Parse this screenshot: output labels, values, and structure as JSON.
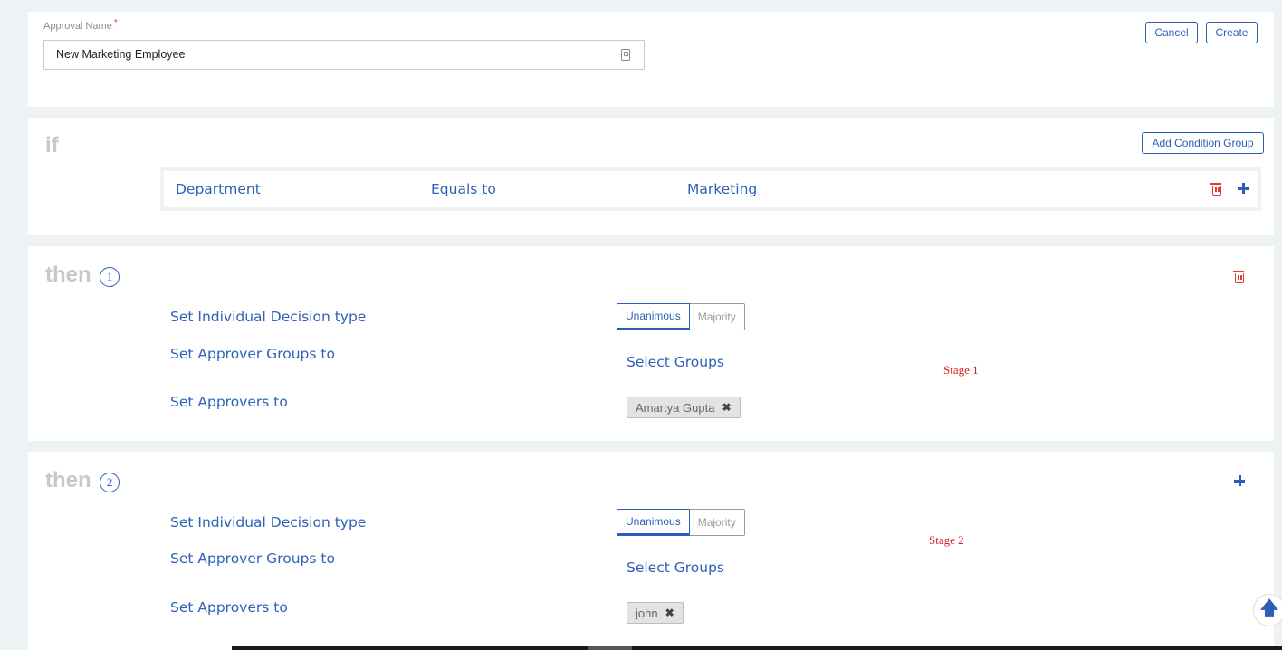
{
  "approval": {
    "label": "Approval Name",
    "required_mark": "*",
    "value": "New Marketing Employee",
    "cancel_label": "Cancel",
    "create_label": "Create"
  },
  "if_section": {
    "keyword": "if",
    "add_condition_group_label": "Add Condition Group",
    "condition": {
      "field": "Department",
      "operator": "Equals to",
      "value": "Marketing"
    }
  },
  "stages": [
    {
      "keyword": "then",
      "number": "1",
      "decision_label": "Set Individual Decision type",
      "decision_options": [
        "Unanimous",
        "Majority"
      ],
      "decision_selected": "Unanimous",
      "groups_label": "Set Approver Groups to",
      "groups_placeholder": "Select Groups",
      "approvers_label": "Set Approvers to",
      "approvers": [
        "Amartya Gupta"
      ],
      "annotation": "Stage 1",
      "action_icon": "trash-icon"
    },
    {
      "keyword": "then",
      "number": "2",
      "decision_label": "Set Individual Decision type",
      "decision_options": [
        "Unanimous",
        "Majority"
      ],
      "decision_selected": "Unanimous",
      "groups_label": "Set Approver Groups to",
      "groups_placeholder": "Select Groups",
      "approvers_label": "Set Approvers to",
      "approvers": [
        "john"
      ],
      "annotation": "Stage 2",
      "action_icon": "plus-icon"
    }
  ],
  "icons": {
    "chip_remove": "✖",
    "scroll_top": "🡅"
  },
  "colors": {
    "accent": "#2b5fb5",
    "delete": "#e53935",
    "annotation": "#d01f1f",
    "keyword": "#c8c8c8"
  }
}
